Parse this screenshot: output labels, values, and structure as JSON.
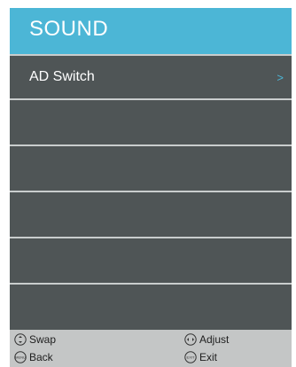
{
  "menu": {
    "title": "SOUND",
    "items": [
      {
        "label": "AD Switch",
        "arrow": ">"
      },
      {
        "label": "",
        "arrow": ""
      },
      {
        "label": "",
        "arrow": ""
      },
      {
        "label": "",
        "arrow": ""
      },
      {
        "label": "",
        "arrow": ""
      },
      {
        "label": "",
        "arrow": ""
      }
    ]
  },
  "footer": {
    "hints": [
      {
        "icon": "up-down-icon",
        "label": "Swap"
      },
      {
        "icon": "left-right-icon",
        "label": "Adjust"
      },
      {
        "icon": "menu-key-icon",
        "label": "Back",
        "key_text": "MENU"
      },
      {
        "icon": "exit-key-icon",
        "label": "Exit",
        "key_text": "EXIT"
      }
    ]
  },
  "colors": {
    "header_bg": "#4cb6d6",
    "list_bg": "#4f5556",
    "divider": "#c9cdcd",
    "footer_bg": "#c4c6c6",
    "accent": "#4cb6d6"
  }
}
